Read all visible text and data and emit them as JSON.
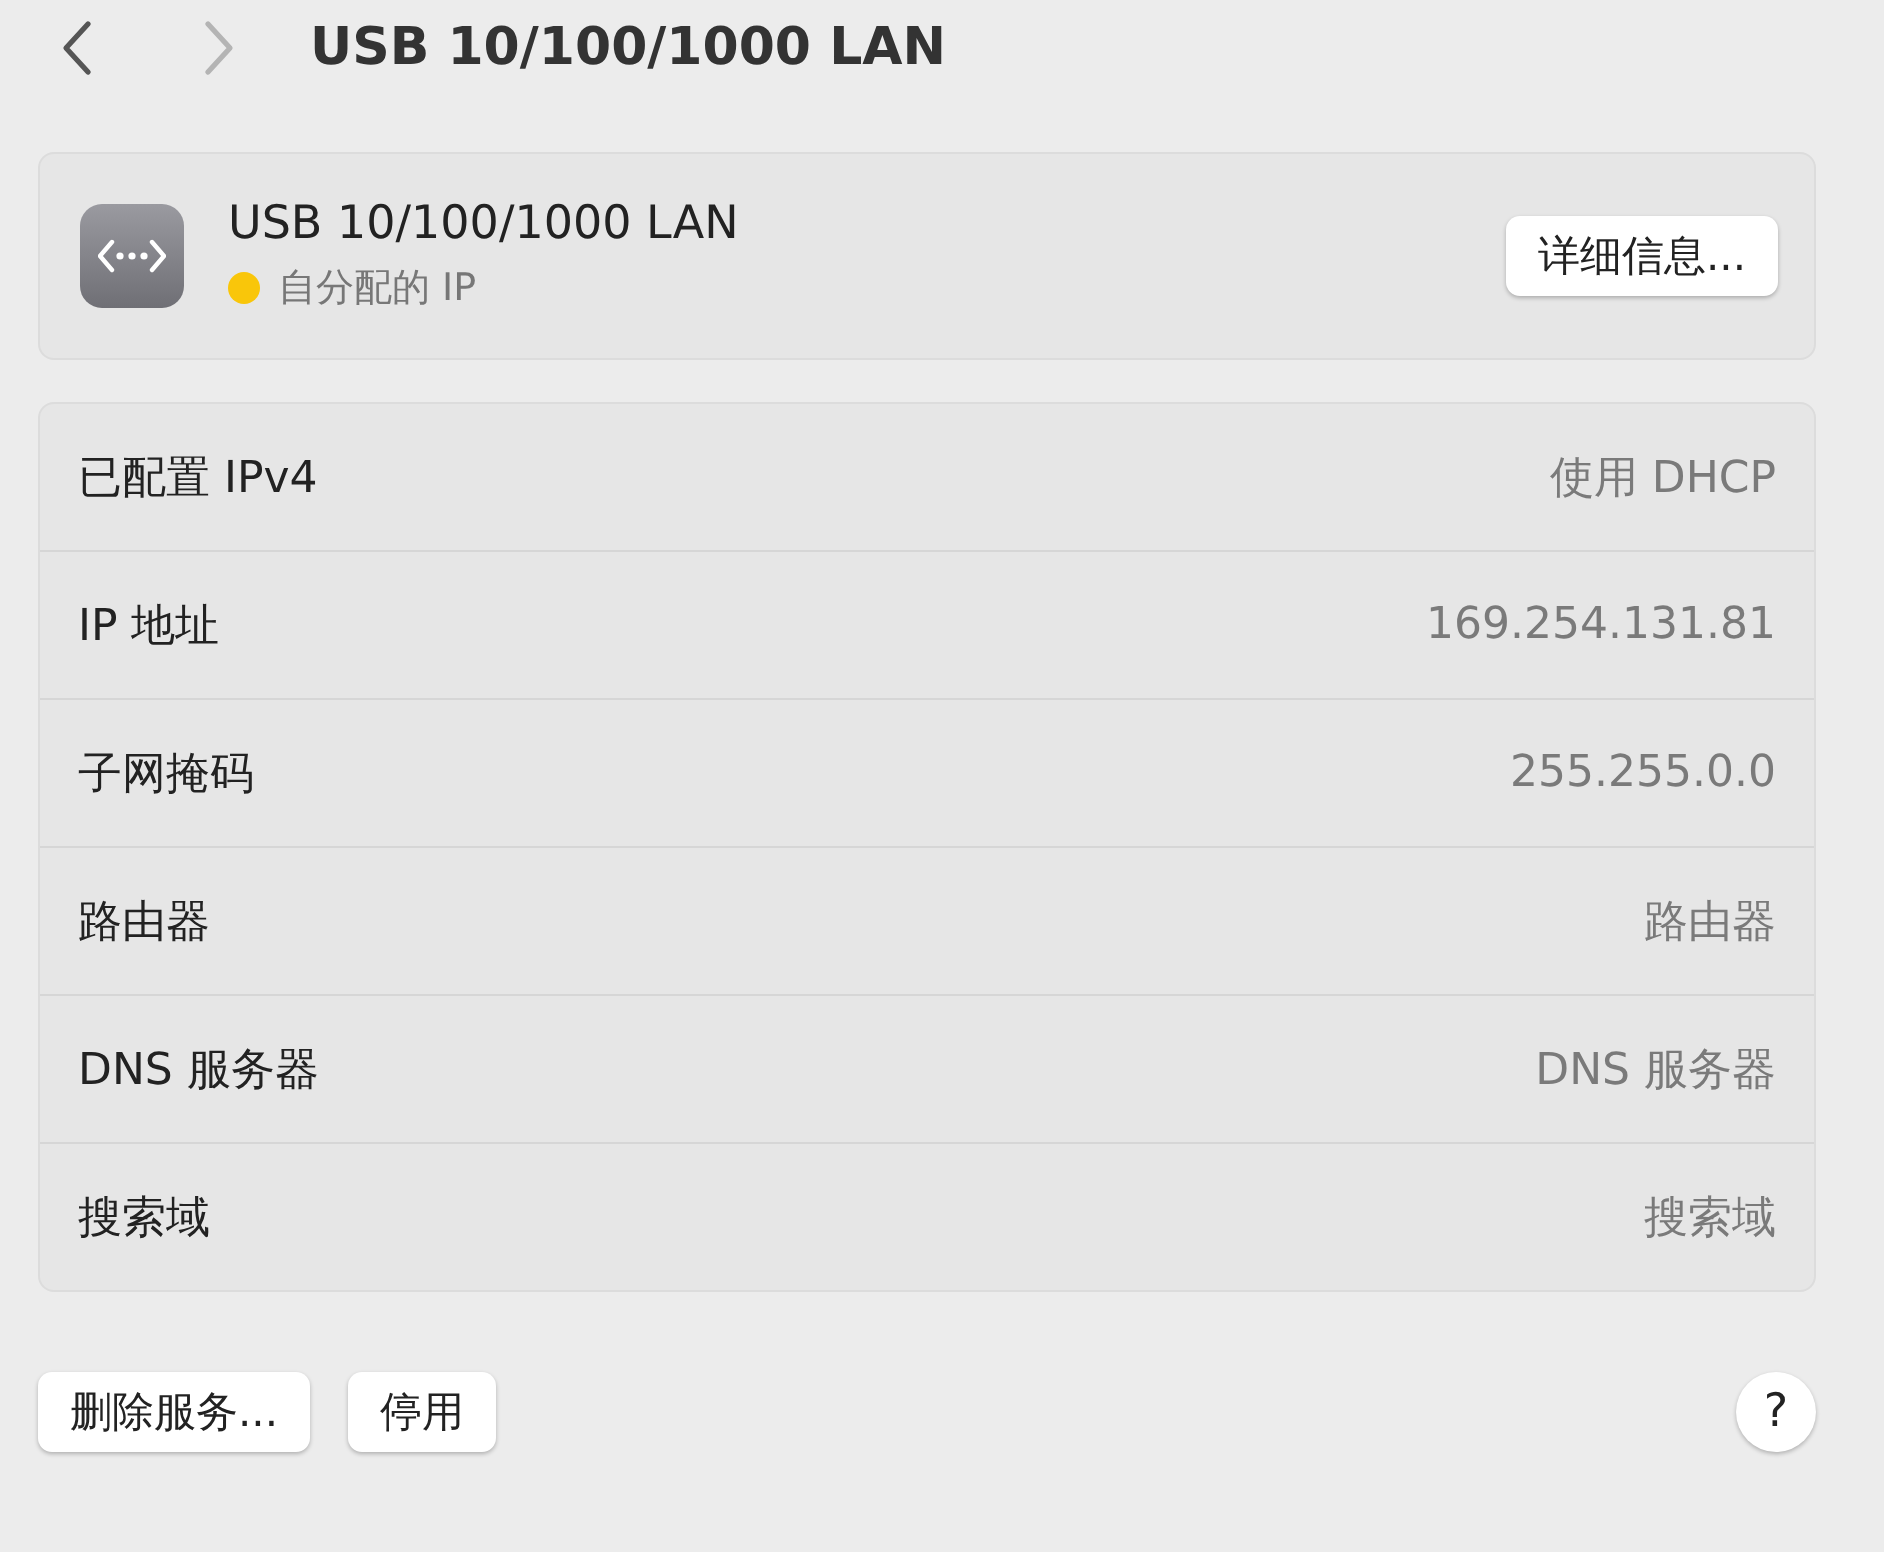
{
  "toolbar": {
    "back": {
      "disabled": false
    },
    "forward": {
      "disabled": true
    },
    "title": "USB 10/100/1000 LAN"
  },
  "service": {
    "name": "USB 10/100/1000 LAN",
    "status": "自分配的 IP",
    "color": "#f9c60a",
    "details_button": "详细信息..."
  },
  "rows": [
    {
      "label": "已配置 IPv4",
      "value": "使用 DHCP"
    },
    {
      "label": "IP 地址",
      "value": "169.254.131.81"
    },
    {
      "label": "子网掩码",
      "value": "255.255.0.0"
    },
    {
      "label": "路由器",
      "value": "路由器"
    },
    {
      "label": "DNS 服务器",
      "value": "DNS 服务器"
    },
    {
      "label": "搜索域",
      "value": "搜索域"
    }
  ],
  "buttons": [
    "删除服务...",
    "停用"
  ],
  "help": "?"
}
